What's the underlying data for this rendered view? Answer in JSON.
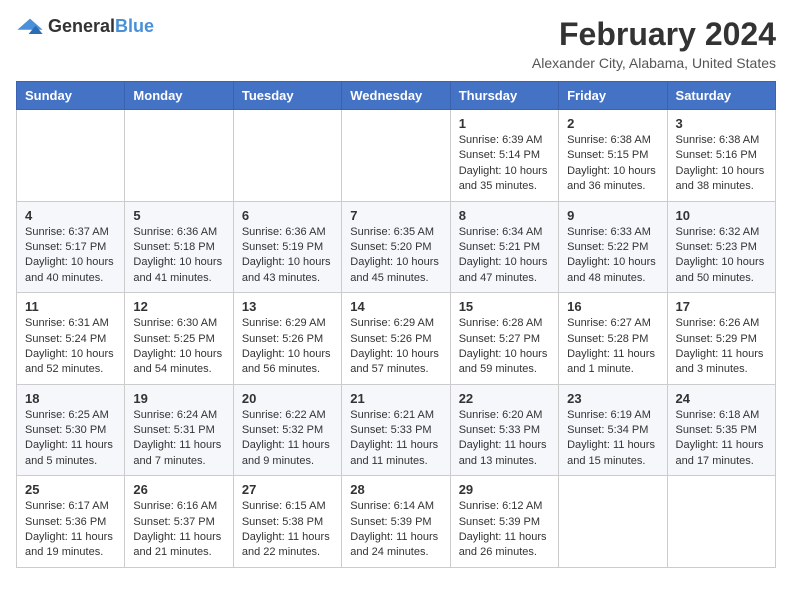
{
  "logo": {
    "text_general": "General",
    "text_blue": "Blue"
  },
  "header": {
    "title": "February 2024",
    "subtitle": "Alexander City, Alabama, United States"
  },
  "days_of_week": [
    "Sunday",
    "Monday",
    "Tuesday",
    "Wednesday",
    "Thursday",
    "Friday",
    "Saturday"
  ],
  "weeks": [
    [
      {
        "day": "",
        "info": ""
      },
      {
        "day": "",
        "info": ""
      },
      {
        "day": "",
        "info": ""
      },
      {
        "day": "",
        "info": ""
      },
      {
        "day": "1",
        "info": "Sunrise: 6:39 AM\nSunset: 5:14 PM\nDaylight: 10 hours\nand 35 minutes."
      },
      {
        "day": "2",
        "info": "Sunrise: 6:38 AM\nSunset: 5:15 PM\nDaylight: 10 hours\nand 36 minutes."
      },
      {
        "day": "3",
        "info": "Sunrise: 6:38 AM\nSunset: 5:16 PM\nDaylight: 10 hours\nand 38 minutes."
      }
    ],
    [
      {
        "day": "4",
        "info": "Sunrise: 6:37 AM\nSunset: 5:17 PM\nDaylight: 10 hours\nand 40 minutes."
      },
      {
        "day": "5",
        "info": "Sunrise: 6:36 AM\nSunset: 5:18 PM\nDaylight: 10 hours\nand 41 minutes."
      },
      {
        "day": "6",
        "info": "Sunrise: 6:36 AM\nSunset: 5:19 PM\nDaylight: 10 hours\nand 43 minutes."
      },
      {
        "day": "7",
        "info": "Sunrise: 6:35 AM\nSunset: 5:20 PM\nDaylight: 10 hours\nand 45 minutes."
      },
      {
        "day": "8",
        "info": "Sunrise: 6:34 AM\nSunset: 5:21 PM\nDaylight: 10 hours\nand 47 minutes."
      },
      {
        "day": "9",
        "info": "Sunrise: 6:33 AM\nSunset: 5:22 PM\nDaylight: 10 hours\nand 48 minutes."
      },
      {
        "day": "10",
        "info": "Sunrise: 6:32 AM\nSunset: 5:23 PM\nDaylight: 10 hours\nand 50 minutes."
      }
    ],
    [
      {
        "day": "11",
        "info": "Sunrise: 6:31 AM\nSunset: 5:24 PM\nDaylight: 10 hours\nand 52 minutes."
      },
      {
        "day": "12",
        "info": "Sunrise: 6:30 AM\nSunset: 5:25 PM\nDaylight: 10 hours\nand 54 minutes."
      },
      {
        "day": "13",
        "info": "Sunrise: 6:29 AM\nSunset: 5:26 PM\nDaylight: 10 hours\nand 56 minutes."
      },
      {
        "day": "14",
        "info": "Sunrise: 6:29 AM\nSunset: 5:26 PM\nDaylight: 10 hours\nand 57 minutes."
      },
      {
        "day": "15",
        "info": "Sunrise: 6:28 AM\nSunset: 5:27 PM\nDaylight: 10 hours\nand 59 minutes."
      },
      {
        "day": "16",
        "info": "Sunrise: 6:27 AM\nSunset: 5:28 PM\nDaylight: 11 hours\nand 1 minute."
      },
      {
        "day": "17",
        "info": "Sunrise: 6:26 AM\nSunset: 5:29 PM\nDaylight: 11 hours\nand 3 minutes."
      }
    ],
    [
      {
        "day": "18",
        "info": "Sunrise: 6:25 AM\nSunset: 5:30 PM\nDaylight: 11 hours\nand 5 minutes."
      },
      {
        "day": "19",
        "info": "Sunrise: 6:24 AM\nSunset: 5:31 PM\nDaylight: 11 hours\nand 7 minutes."
      },
      {
        "day": "20",
        "info": "Sunrise: 6:22 AM\nSunset: 5:32 PM\nDaylight: 11 hours\nand 9 minutes."
      },
      {
        "day": "21",
        "info": "Sunrise: 6:21 AM\nSunset: 5:33 PM\nDaylight: 11 hours\nand 11 minutes."
      },
      {
        "day": "22",
        "info": "Sunrise: 6:20 AM\nSunset: 5:33 PM\nDaylight: 11 hours\nand 13 minutes."
      },
      {
        "day": "23",
        "info": "Sunrise: 6:19 AM\nSunset: 5:34 PM\nDaylight: 11 hours\nand 15 minutes."
      },
      {
        "day": "24",
        "info": "Sunrise: 6:18 AM\nSunset: 5:35 PM\nDaylight: 11 hours\nand 17 minutes."
      }
    ],
    [
      {
        "day": "25",
        "info": "Sunrise: 6:17 AM\nSunset: 5:36 PM\nDaylight: 11 hours\nand 19 minutes."
      },
      {
        "day": "26",
        "info": "Sunrise: 6:16 AM\nSunset: 5:37 PM\nDaylight: 11 hours\nand 21 minutes."
      },
      {
        "day": "27",
        "info": "Sunrise: 6:15 AM\nSunset: 5:38 PM\nDaylight: 11 hours\nand 22 minutes."
      },
      {
        "day": "28",
        "info": "Sunrise: 6:14 AM\nSunset: 5:39 PM\nDaylight: 11 hours\nand 24 minutes."
      },
      {
        "day": "29",
        "info": "Sunrise: 6:12 AM\nSunset: 5:39 PM\nDaylight: 11 hours\nand 26 minutes."
      },
      {
        "day": "",
        "info": ""
      },
      {
        "day": "",
        "info": ""
      }
    ]
  ]
}
